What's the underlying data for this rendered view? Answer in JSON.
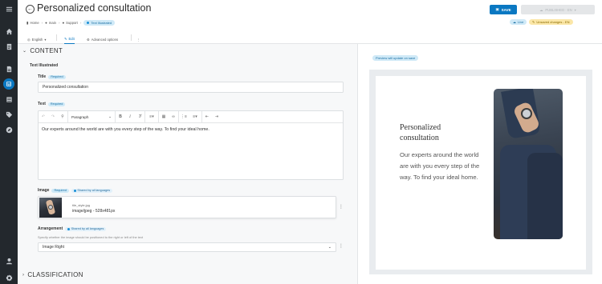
{
  "header": {
    "title": "Personalized consultation",
    "breadcrumb": [
      "Home",
      "main",
      "Support"
    ],
    "status_badge": "Text Illustrated",
    "save_label": "SAVE",
    "published_label": "PUBLISHED - EN",
    "live_badge": "Live",
    "unsaved_badge": "Unsaved changes - EN"
  },
  "tabs": {
    "language": "English",
    "edit": "Edit",
    "advanced": "Advanced options"
  },
  "content": {
    "section_title": "CONTENT",
    "group_label": "Text Illustrated",
    "title_label": "Title",
    "title_required": "Required",
    "title_value": "Personalized consultation",
    "text_label": "Text",
    "text_required": "Required",
    "text_value": "Our experts around the world are with you every step of the way. To find your ideal home.",
    "paragraph_select": "Paragraph",
    "image_label": "Image",
    "image_required": "Required",
    "image_shared": "Shared by all languages",
    "image_filename": "tile_style.jpg",
    "image_meta": "image/jpeg - 528x481px",
    "arrangement_label": "Arrangement",
    "arrangement_shared": "Shared by all languages",
    "arrangement_help": "Specify whether the image should be positioned to the right or left of the text",
    "arrangement_value": "Image Right"
  },
  "classification": {
    "section_title": "CLASSIFICATION"
  },
  "preview": {
    "note": "Preview will update on save",
    "title": "Personalized consultation",
    "text": "Our experts around the world are with you every step of the way. To find your ideal home."
  },
  "colors": {
    "accent": "#0a78c2",
    "rail": "#23282d",
    "badge_bg": "#cfe9f7",
    "unsaved_bg": "#fbe7a8"
  },
  "icons": [
    "menu-icon",
    "home-icon",
    "document-icon",
    "file-icon",
    "page-icon",
    "list-icon",
    "tag-icon",
    "compass-icon",
    "user-icon",
    "gear-icon"
  ]
}
